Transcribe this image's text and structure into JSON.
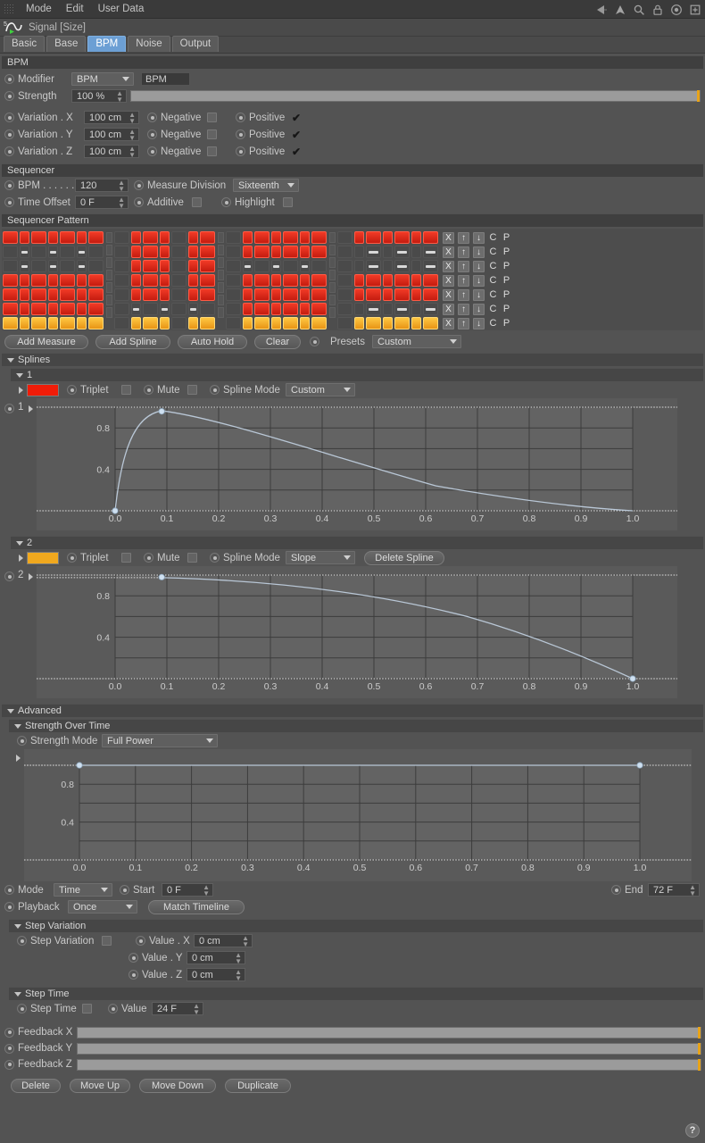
{
  "menubar": {
    "items": [
      "Mode",
      "Edit",
      "User Data"
    ],
    "icons": [
      "back-arrow-icon",
      "up-arrow-icon",
      "search-icon",
      "lock-icon",
      "target-icon",
      "add-panel-icon"
    ]
  },
  "object": {
    "icon": "signal-curve-icon",
    "title": "Signal [Size]"
  },
  "tabs": [
    {
      "label": "Basic",
      "active": false
    },
    {
      "label": "Base",
      "active": false
    },
    {
      "label": "BPM",
      "active": true
    },
    {
      "label": "Noise",
      "active": false
    },
    {
      "label": "Output",
      "active": false
    }
  ],
  "bpm_group": {
    "header": "BPM",
    "modifier_label": "Modifier",
    "modifier_value": "BPM",
    "modifier_name": "BPM",
    "strength_label": "Strength",
    "strength_value": "100 %",
    "strength_slider_pct": 100,
    "variations": [
      {
        "label": "Variation . X",
        "value": "100 cm",
        "negative_label": "Negative",
        "negative_checked": false,
        "positive_label": "Positive",
        "positive_checked": true
      },
      {
        "label": "Variation . Y",
        "value": "100 cm",
        "negative_label": "Negative",
        "negative_checked": false,
        "positive_label": "Positive",
        "positive_checked": true
      },
      {
        "label": "Variation . Z",
        "value": "100 cm",
        "negative_label": "Negative",
        "negative_checked": false,
        "positive_label": "Positive",
        "positive_checked": true
      }
    ]
  },
  "sequencer": {
    "header": "Sequencer",
    "bpm_label": "BPM . . . . . .",
    "bpm_value": "120",
    "measure_division_label": "Measure Division",
    "measure_division_value": "Sixteenth",
    "time_offset_label": "Time Offset",
    "time_offset_value": "0 F",
    "additive_label": "Additive",
    "additive_checked": false,
    "highlight_label": "Highlight",
    "highlight_checked": false
  },
  "pattern": {
    "header": "Sequencer Pattern",
    "colors": {
      "red": "#e8281a",
      "orange": "#f0a81e",
      "off": "#4a4a4a"
    },
    "row_controls": [
      "X",
      "↑",
      "↓",
      "C",
      "P"
    ],
    "measures": [
      {
        "rows": [
          [
            "red",
            "red",
            "red",
            "red",
            "red",
            "red",
            "red"
          ],
          [
            "off",
            "hl",
            "off",
            "hl",
            "off",
            "hl",
            "off"
          ],
          [
            "off",
            "hl",
            "off",
            "hl",
            "off",
            "hl",
            "off"
          ],
          [
            "red",
            "red",
            "red",
            "red",
            "red",
            "red",
            "red"
          ],
          [
            "red",
            "red",
            "red",
            "red",
            "red",
            "red",
            "red"
          ],
          [
            "red",
            "red",
            "red",
            "red",
            "red",
            "red",
            "red"
          ],
          [
            "orange",
            "orange",
            "orange",
            "orange",
            "orange",
            "orange",
            "orange"
          ]
        ]
      },
      {
        "rows": [
          [
            "off",
            "red",
            "red",
            "red",
            "off",
            "red",
            "red"
          ],
          [
            "off",
            "red",
            "red",
            "red",
            "off",
            "red",
            "red"
          ],
          [
            "off",
            "red",
            "red",
            "red",
            "off",
            "red",
            "red"
          ],
          [
            "off",
            "red",
            "red",
            "red",
            "off",
            "red",
            "red"
          ],
          [
            "off",
            "red",
            "red",
            "red",
            "off",
            "red",
            "red"
          ],
          [
            "off",
            "hl",
            "off",
            "hl",
            "off",
            "hl",
            "off"
          ],
          [
            "off",
            "orange",
            "orange",
            "orange",
            "off",
            "orange",
            "orange"
          ]
        ]
      },
      {
        "rows": [
          [
            "off",
            "red",
            "red",
            "red",
            "red",
            "red",
            "red"
          ],
          [
            "off",
            "red",
            "red",
            "red",
            "red",
            "red",
            "red"
          ],
          [
            "off",
            "hl",
            "off",
            "hl",
            "off",
            "hl",
            "off"
          ],
          [
            "off",
            "red",
            "red",
            "red",
            "red",
            "red",
            "red"
          ],
          [
            "off",
            "red",
            "red",
            "red",
            "red",
            "red",
            "red"
          ],
          [
            "off",
            "red",
            "red",
            "red",
            "red",
            "red",
            "red"
          ],
          [
            "off",
            "orange",
            "orange",
            "orange",
            "orange",
            "orange",
            "orange"
          ]
        ]
      },
      {
        "rows": [
          [
            "off",
            "red",
            "red",
            "red",
            "red",
            "red",
            "red"
          ],
          [
            "off",
            "off",
            "hl",
            "off",
            "hl",
            "off",
            "hl"
          ],
          [
            "off",
            "off",
            "hl",
            "off",
            "hl",
            "off",
            "hl"
          ],
          [
            "off",
            "red",
            "red",
            "red",
            "red",
            "red",
            "red"
          ],
          [
            "off",
            "red",
            "red",
            "red",
            "red",
            "red",
            "red"
          ],
          [
            "off",
            "off",
            "hl",
            "off",
            "hl",
            "off",
            "hl"
          ],
          [
            "off",
            "orange",
            "orange",
            "orange",
            "orange",
            "orange",
            "orange"
          ]
        ]
      }
    ]
  },
  "pattern_buttons": {
    "add_measure": "Add Measure",
    "add_spline": "Add Spline",
    "auto_hold": "Auto Hold",
    "clear": "Clear",
    "presets_label": "Presets",
    "presets_value": "Custom"
  },
  "splines": {
    "header": "Splines",
    "items": [
      {
        "index": "1",
        "color": "#f01c08",
        "triplet_label": "Triplet",
        "triplet_checked": false,
        "mute_label": "Mute",
        "mute_checked": false,
        "spline_mode_label": "Spline Mode",
        "spline_mode_value": "Custom",
        "delete_label": null,
        "graph": {
          "ylabels": [
            "0.8",
            "0.4"
          ],
          "xlabels": [
            "0.0",
            "0.1",
            "0.2",
            "0.3",
            "0.4",
            "0.5",
            "0.6",
            "0.7",
            "0.8",
            "0.9",
            "1.0"
          ],
          "points": [
            [
              0.0,
              0.0
            ],
            [
              0.09,
              0.96
            ]
          ],
          "curve": "attack-decay"
        }
      },
      {
        "index": "2",
        "color": "#f0a81e",
        "triplet_label": "Triplet",
        "triplet_checked": false,
        "mute_label": "Mute",
        "mute_checked": false,
        "spline_mode_label": "Spline Mode",
        "spline_mode_value": "Slope",
        "delete_label": "Delete Spline",
        "graph": {
          "ylabels": [
            "0.8",
            "0.4"
          ],
          "xlabels": [
            "0.0",
            "0.1",
            "0.2",
            "0.3",
            "0.4",
            "0.5",
            "0.6",
            "0.7",
            "0.8",
            "0.9",
            "1.0"
          ],
          "points": [
            [
              0.09,
              0.98
            ],
            [
              1.0,
              0.0
            ]
          ],
          "curve": "slope-down"
        }
      }
    ]
  },
  "advanced": {
    "header": "Advanced",
    "strength_over_time": {
      "header": "Strength Over Time",
      "mode_label": "Strength Mode",
      "mode_value": "Full Power",
      "graph": {
        "ylabels": [
          "0.8",
          "0.4"
        ],
        "xlabels": [
          "0.0",
          "0.1",
          "0.2",
          "0.3",
          "0.4",
          "0.5",
          "0.6",
          "0.7",
          "0.8",
          "0.9",
          "1.0"
        ],
        "points": [
          [
            0.0,
            1.0
          ],
          [
            1.0,
            1.0
          ]
        ],
        "curve": "flat-top"
      },
      "mode2_label": "Mode",
      "mode2_value": "Time",
      "start_label": "Start",
      "start_value": "0 F",
      "end_label": "End",
      "end_value": "72 F",
      "playback_label": "Playback",
      "playback_value": "Once",
      "match_timeline": "Match Timeline"
    },
    "step_variation": {
      "header": "Step Variation",
      "toggle_label": "Step Variation",
      "toggle_checked": false,
      "values": [
        {
          "label": "Value . X",
          "value": "0 cm"
        },
        {
          "label": "Value . Y",
          "value": "0 cm"
        },
        {
          "label": "Value . Z",
          "value": "0 cm"
        }
      ]
    },
    "step_time": {
      "header": "Step Time",
      "toggle_label": "Step Time",
      "toggle_checked": false,
      "value_label": "Value",
      "value": "24 F"
    }
  },
  "feedback": [
    {
      "label": "Feedback X",
      "knob_pct": 100
    },
    {
      "label": "Feedback Y",
      "knob_pct": 100
    },
    {
      "label": "Feedback Z",
      "knob_pct": 100
    }
  ],
  "footer_buttons": [
    "Delete",
    "Move Up",
    "Move Down",
    "Duplicate"
  ],
  "help_icon": "?"
}
